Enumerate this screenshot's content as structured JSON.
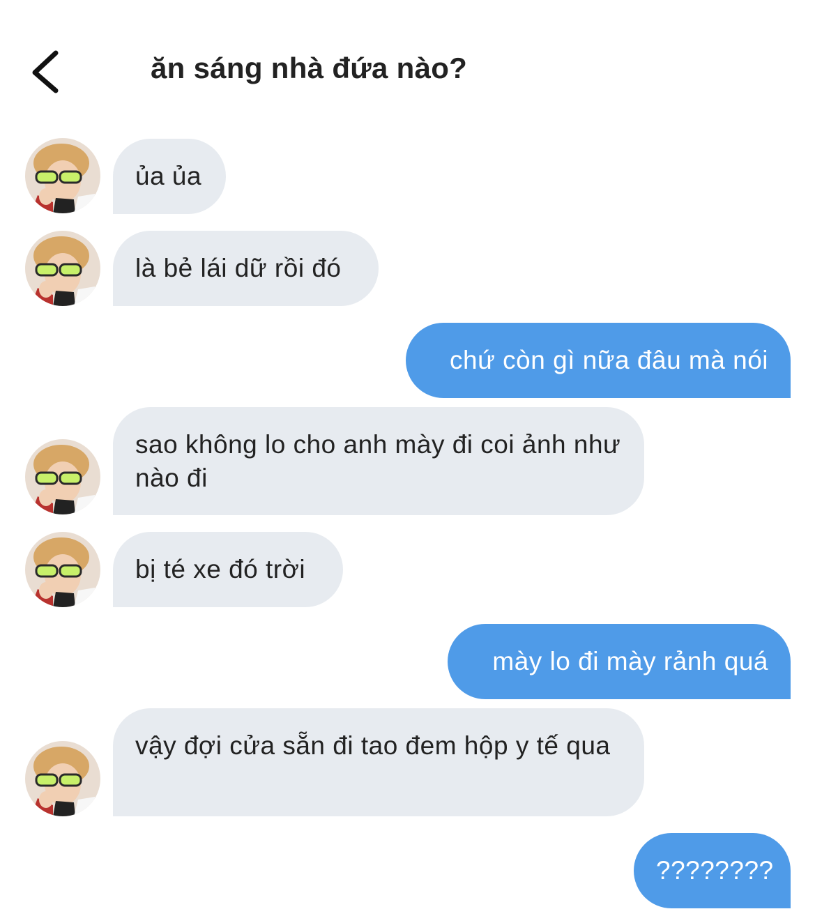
{
  "header": {
    "title": "ăn sáng nhà đứa nào?"
  },
  "messages": [
    {
      "side": "in",
      "text": "ủa ủa"
    },
    {
      "side": "in",
      "text": "là bẻ lái dữ rồi đó"
    },
    {
      "side": "out",
      "text": "chứ còn gì nữa đâu mà nói"
    },
    {
      "side": "in",
      "text": "sao không lo cho anh mày đi coi ảnh như nào đi"
    },
    {
      "side": "in",
      "text": "bị té xe đó trời"
    },
    {
      "side": "out",
      "text": "mày lo đi mày rảnh quá"
    },
    {
      "side": "in",
      "text": "vậy đợi cửa sẵn đi tao đem hộp y tế qua"
    },
    {
      "side": "out",
      "text": "????????"
    }
  ],
  "colors": {
    "incoming_bubble": "#e7ebf0",
    "outgoing_bubble": "#4f9be8",
    "outgoing_text": "#ffffff"
  },
  "icons": {
    "back": "chevron-left-icon",
    "avatar": "contact-avatar"
  }
}
